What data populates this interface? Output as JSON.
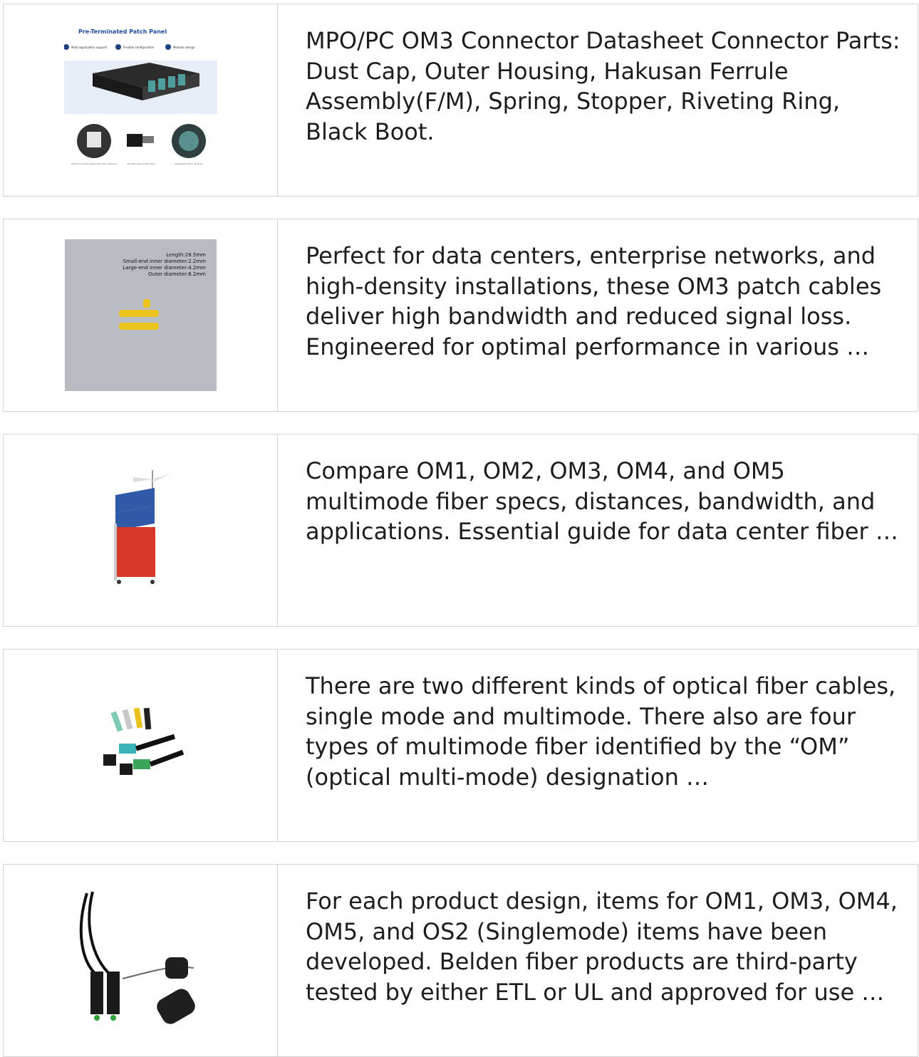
{
  "products": [
    {
      "thumb": {
        "panel_title": "Pre-Terminated Patch Panel",
        "features": [
          "Multi-application support",
          "Flexible configuration",
          "Modular design"
        ],
        "captions": [
          "Multi-functional Sliding Patch Box, Modular",
          "Modular Sliding Patch Box",
          "Sliding Patch Box, Modular"
        ]
      },
      "description": "MPO/PC OM3 Connector Datasheet Connector Parts: Dust Cap, Outer Housing, Hakusan Ferrule Assembly(F/M), Spring, Stopper, Riveting Ring, Black Boot."
    },
    {
      "thumb": {
        "specs": [
          "Length:28.5mm",
          "Small-end inner diameter:2.2mm",
          "Large-end inner diameter:4.2mm",
          "Outer diameter:6.2mm"
        ]
      },
      "description": "Perfect for data centers, enterprise networks, and high-density installations, these OM3 patch cables deliver high bandwidth and reduced signal loss. Engineered for optimal performance in various …"
    },
    {
      "description": "Compare OM1, OM2, OM3, OM4, and OM5 multimode fiber specs, distances, bandwidth, and applications. Essential guide for data center fiber …"
    },
    {
      "description": "There are two different kinds of optical fiber cables, single mode and multimode. There also are four types of multimode fiber identified by the “OM” (optical multi-mode) designation …"
    },
    {
      "description": "For each product design, items for OM1, OM3, OM4, OM5, and OS2 (Singlemode) items have been developed. Belden fiber products are third-party tested by either ETL or UL and approved for use …"
    }
  ]
}
